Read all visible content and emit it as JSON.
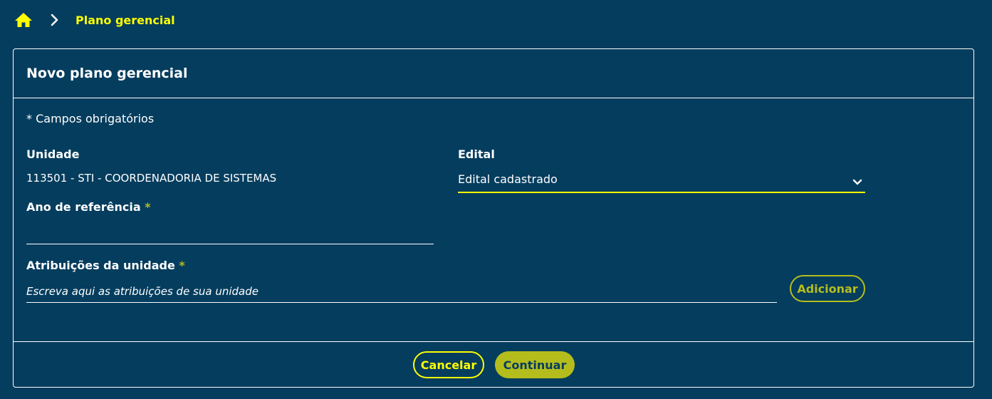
{
  "breadcrumb": {
    "home_icon": "home-icon",
    "separator_icon": "chevron-right-icon",
    "current": "Plano gerencial"
  },
  "card": {
    "title": "Novo plano gerencial",
    "required_note": "* Campos obrigatórios"
  },
  "form": {
    "unidade": {
      "label": "Unidade",
      "value": "113501 - STI - COORDENADORIA DE SISTEMAS"
    },
    "edital": {
      "label": "Edital",
      "selected": "Edital cadastrado",
      "icon": "chevron-down-icon"
    },
    "ano": {
      "label": "Ano de referência",
      "required_mark": "*",
      "value": ""
    },
    "atribuicoes": {
      "label": "Atribuições da unidade",
      "required_mark": "*",
      "placeholder": "Escreva aqui as atribuições de sua unidade",
      "add_label": "Adicionar"
    }
  },
  "footer": {
    "cancel_label": "Cancelar",
    "continue_label": "Continuar"
  },
  "colors": {
    "background": "#053d5e",
    "accent_yellow": "#ffff00",
    "accent_olive": "#b5bd1d",
    "text": "#ffffff"
  }
}
